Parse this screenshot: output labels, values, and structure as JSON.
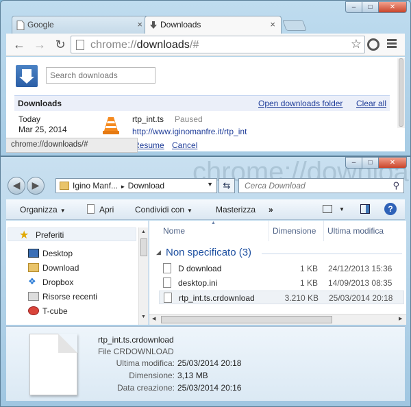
{
  "chrome": {
    "tabs": [
      {
        "label": "Google"
      },
      {
        "label": "Downloads"
      }
    ],
    "tab_close_glyph": "×",
    "address": {
      "scheme": "chrome://",
      "host": "downloads",
      "path": "/#"
    },
    "search": {
      "placeholder": "Search downloads"
    },
    "section_title": "Downloads",
    "open_folder_label": "Open downloads folder",
    "clear_all_label": "Clear all",
    "download": {
      "date_label": "Today",
      "date": "Mar 25, 2014",
      "file_name": "rtp_int.ts",
      "status": "Paused",
      "url": "http://www.iginomanfre.it/rtp_int",
      "resume_label": "Resume",
      "cancel_label": "Cancel"
    },
    "status_bubble": "chrome://downloads/#",
    "colors": {
      "link": "#1f3d99",
      "accent": "#2b5ea6"
    }
  },
  "explorer": {
    "watermark": "chrome://downloads",
    "breadcrumb": [
      "Igino Manf...",
      "Download"
    ],
    "breadcrumb_separator": "►",
    "search_placeholder": "Cerca Download",
    "commands": {
      "organize": "Organizza",
      "open": "Apri",
      "share": "Condividi con",
      "burn": "Masterizza",
      "more": "»"
    },
    "nav": {
      "favorites": "Preferiti",
      "items": [
        {
          "label": "Desktop",
          "icon": "desktop-icon"
        },
        {
          "label": "Download",
          "icon": "download-folder-icon"
        },
        {
          "label": "Dropbox",
          "icon": "dropbox-icon"
        },
        {
          "label": "Risorse recenti",
          "icon": "recent-places-icon"
        },
        {
          "label": "T-cube",
          "icon": "t-cube-icon"
        }
      ]
    },
    "columns": {
      "name": "Nome",
      "size": "Dimensione",
      "modified": "Ultima modifica"
    },
    "group": "Non specificato (3)",
    "files": [
      {
        "name": "D download",
        "size": "1 KB",
        "modified": "24/12/2013 15:36",
        "icon": "shortcut-icon"
      },
      {
        "name": "desktop.ini",
        "size": "1 KB",
        "modified": "14/09/2013 08:35",
        "icon": "ini-file-icon"
      },
      {
        "name": "rtp_int.ts.crdownload",
        "size": "3.210 KB",
        "modified": "25/03/2014 20:18",
        "icon": "file-icon"
      }
    ],
    "details": {
      "file_name": "rtp_int.ts.crdownload",
      "file_type": "File CRDOWNLOAD",
      "modified_label": "Ultima modifica:",
      "modified_value": "25/03/2014 20:18",
      "size_label": "Dimensione:",
      "size_value": "3,13 MB",
      "created_label": "Data creazione:",
      "created_value": "25/03/2014 20:16"
    }
  }
}
